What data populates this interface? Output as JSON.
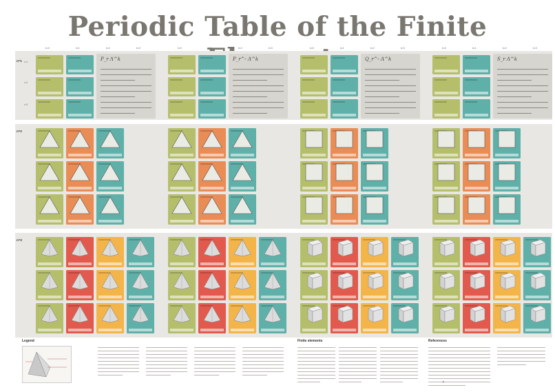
{
  "title": "Periodic Table of the Finite Elements",
  "dimensions": [
    "n=1",
    "n=2",
    "n=3"
  ],
  "degrees": [
    "r=1",
    "r=2",
    "r=3"
  ],
  "column_headers": [
    "k=0",
    "k=1",
    "k=2",
    "k=3"
  ],
  "families": [
    "P_r Λ^k",
    "P_r^- Λ^k",
    "Q_r^- Λ^k",
    "S_r Λ^k"
  ],
  "footer": {
    "legend": "Legend",
    "finite_elements": "Finite elements",
    "references": "References"
  },
  "colors": {
    "k0": "#b5bf6b",
    "k1_2d": "#e98c55",
    "k_top": "#5fb0a8",
    "k1_3d": "#e25a4d",
    "k2_3d": "#f3b54a",
    "title": "#7a7670",
    "band": "#e8e7e3"
  }
}
